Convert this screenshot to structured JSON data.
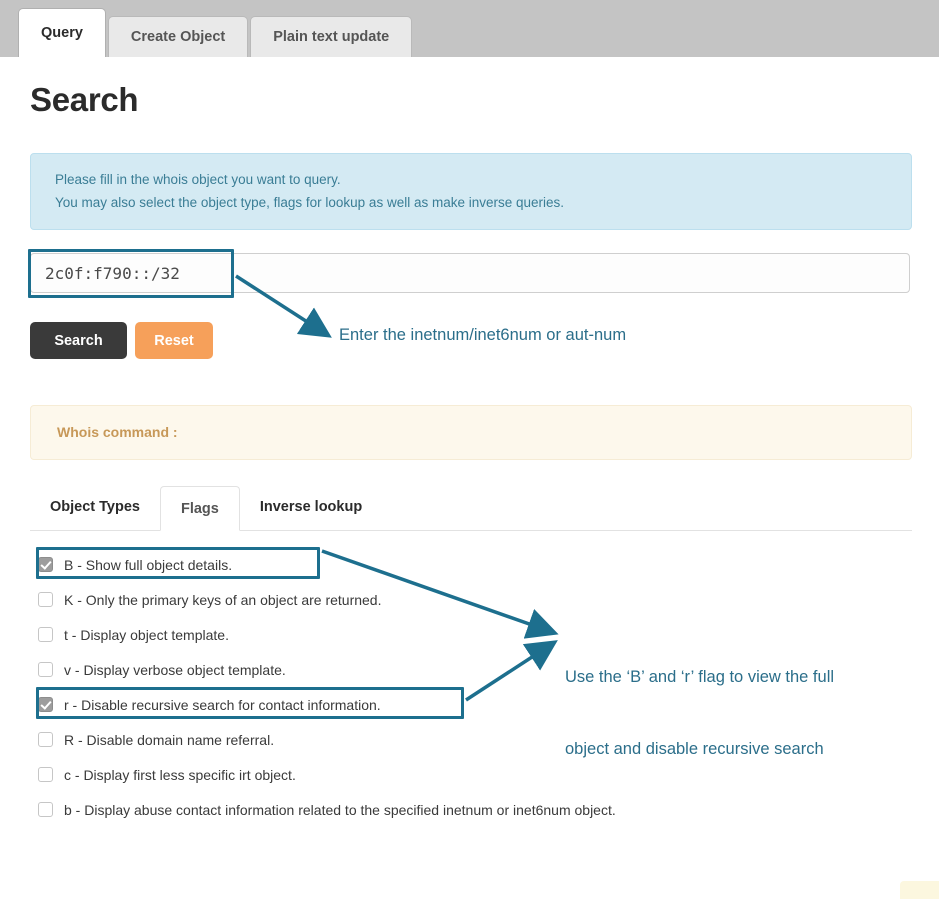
{
  "top_tabs": [
    {
      "label": "Query",
      "active": true
    },
    {
      "label": "Create Object",
      "active": false
    },
    {
      "label": "Plain text update",
      "active": false
    }
  ],
  "page": {
    "title": "Search"
  },
  "info_alert": {
    "line1": "Please fill in the whois object you want to query.",
    "line2": "You may also select the object type, flags for lookup as well as make inverse queries."
  },
  "search": {
    "value": "2c0f:f790::/32",
    "placeholder": ""
  },
  "buttons": {
    "search_label": "Search",
    "reset_label": "Reset"
  },
  "whois_alert": {
    "label": "Whois command :"
  },
  "inner_tabs": [
    {
      "label": "Object Types",
      "active": false
    },
    {
      "label": "Flags",
      "active": true
    },
    {
      "label": "Inverse lookup",
      "active": false
    }
  ],
  "flags": [
    {
      "label": "B - Show full object details.",
      "checked": true
    },
    {
      "label": "K - Only the primary keys of an object are returned.",
      "checked": false
    },
    {
      "label": "t - Display object template.",
      "checked": false
    },
    {
      "label": "v - Display verbose object template.",
      "checked": false
    },
    {
      "label": "r - Disable recursive search for contact information.",
      "checked": true
    },
    {
      "label": "R - Disable domain name referral.",
      "checked": false
    },
    {
      "label": "c - Display first less specific irt object.",
      "checked": false
    },
    {
      "label": "b - Display abuse contact information related to the specified inetnum or inet6num object.",
      "checked": false
    }
  ],
  "annotations": {
    "input_hint": "Enter the inetnum/inet6num or aut-num",
    "flags_hint_line1": "Use the ‘B’ and ‘r’ flag to view the full",
    "flags_hint_line2": "object and disable recursive search"
  },
  "colors": {
    "annotation": "#2b6e8a",
    "info_bg": "#d4eaf3",
    "info_text": "#3a7d95",
    "whois_bg": "#fdf8ec",
    "whois_text": "#c79858",
    "search_btn": "#3a3a3a",
    "reset_btn": "#f6a05a"
  }
}
